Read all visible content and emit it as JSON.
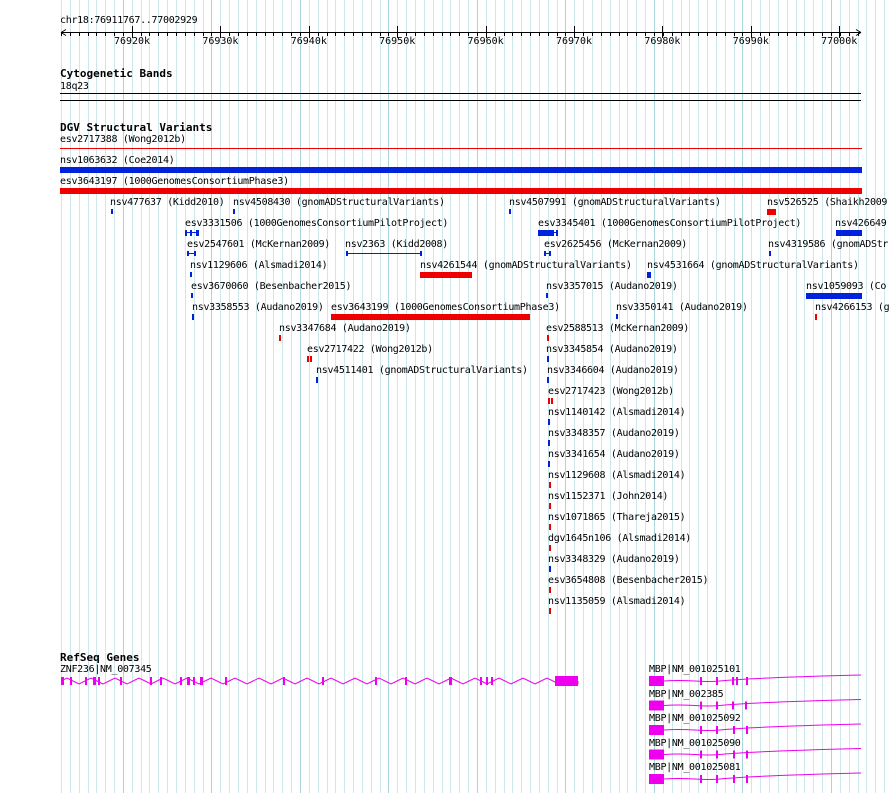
{
  "ruler": {
    "locus": "chr18:76911767..77002929",
    "ticks": [
      "76920k",
      "76930k",
      "76940k",
      "76950k",
      "76960k",
      "76970k",
      "76980k",
      "76990k",
      "77000k"
    ]
  },
  "cytoband": {
    "title": "Cytogenetic Bands",
    "band": "18q23"
  },
  "dgv": {
    "title": "DGV Structural Variants",
    "colors": {
      "loss": "#ee0000",
      "gain": "#0022dd"
    },
    "wide": [
      {
        "label": "esv2717388 (Wong2012b)",
        "color": "loss"
      },
      {
        "label": "nsv1063632 (Coe2014)",
        "color": "gain"
      },
      {
        "label": "esv3643197 (1000GenomesConsortiumPhase3)",
        "color": "loss"
      }
    ],
    "features": [
      {
        "label": "nsv477637 (Kidd2010)",
        "color": "gain"
      },
      {
        "label": "nsv4508430 (gnomADStructuralVariants)",
        "color": "gain"
      },
      {
        "label": "nsv4507991 (gnomADStructuralVariants)",
        "color": "gain"
      },
      {
        "label": "nsv526525 (Shaikh2009",
        "color": "loss"
      },
      {
        "label": "esv3331506 (1000GenomesConsortiumPilotProject)",
        "color": "gain"
      },
      {
        "label": "esv3345401 (1000GenomesConsortiumPilotProject)",
        "color": "gain"
      },
      {
        "label": "nsv426649",
        "color": "gain"
      },
      {
        "label": "esv2547601 (McKernan2009)",
        "color": "gain"
      },
      {
        "label": "nsv2363 (Kidd2008)",
        "color": "gain"
      },
      {
        "label": "esv2625456 (McKernan2009)",
        "color": "gain"
      },
      {
        "label": "nsv4319586 (gnomADStr",
        "color": "gain"
      },
      {
        "label": "nsv1129606 (Alsmadi2014)",
        "color": "gain"
      },
      {
        "label": "nsv4261544 (gnomADStructuralVariants)",
        "color": "loss"
      },
      {
        "label": "nsv4531664 (gnomADStructuralVariants)",
        "color": "gain"
      },
      {
        "label": "esv3670060 (Besenbacher2015)",
        "color": "gain"
      },
      {
        "label": "nsv3357015 (Audano2019)",
        "color": "gain"
      },
      {
        "label": "nsv1059093 (Co",
        "color": "gain"
      },
      {
        "label": "nsv3358553 (Audano2019)",
        "color": "gain"
      },
      {
        "label": "esv3643199 (1000GenomesConsortiumPhase3)",
        "color": "loss"
      },
      {
        "label": "nsv3350141 (Audano2019)",
        "color": "gain"
      },
      {
        "label": "nsv4266153 (g",
        "color": "loss"
      },
      {
        "label": "nsv3347684 (Audano2019)",
        "color": "loss"
      },
      {
        "label": "esv2588513 (McKernan2009)",
        "color": "loss"
      },
      {
        "label": "esv2717422 (Wong2012b)",
        "color": "loss"
      },
      {
        "label": "nsv3345854 (Audano2019)",
        "color": "gain"
      },
      {
        "label": "nsv4511401 (gnomADStructuralVariants)",
        "color": "gain"
      },
      {
        "label": "nsv3346604 (Audano2019)",
        "color": "gain"
      },
      {
        "label": "esv2717423 (Wong2012b)",
        "color": "loss"
      },
      {
        "label": "nsv1140142 (Alsmadi2014)",
        "color": "gain"
      },
      {
        "label": "nsv3348357 (Audano2019)",
        "color": "gain"
      },
      {
        "label": "nsv3341654 (Audano2019)",
        "color": "gain"
      },
      {
        "label": "nsv1129608 (Alsmadi2014)",
        "color": "loss"
      },
      {
        "label": "nsv1152371 (John2014)",
        "color": "loss"
      },
      {
        "label": "nsv1071865 (Thareja2015)",
        "color": "loss"
      },
      {
        "label": "dgv1645n106 (Alsmadi2014)",
        "color": "loss"
      },
      {
        "label": "nsv3348329 (Audano2019)",
        "color": "gain"
      },
      {
        "label": "esv3654808 (Besenbacher2015)",
        "color": "loss"
      },
      {
        "label": "nsv1135059 (Alsmadi2014)",
        "color": "loss"
      }
    ]
  },
  "refseq": {
    "title": "RefSeq Genes",
    "gene_color": "#ee00ee",
    "genes": [
      {
        "label": "ZNF236|NM_007345"
      },
      {
        "label": "MBP|NM_001025101"
      },
      {
        "label": "MBP|NM_002385"
      },
      {
        "label": "MBP|NM_001025092"
      },
      {
        "label": "MBP|NM_001025090"
      },
      {
        "label": "MBP|NM_001025081"
      }
    ]
  }
}
